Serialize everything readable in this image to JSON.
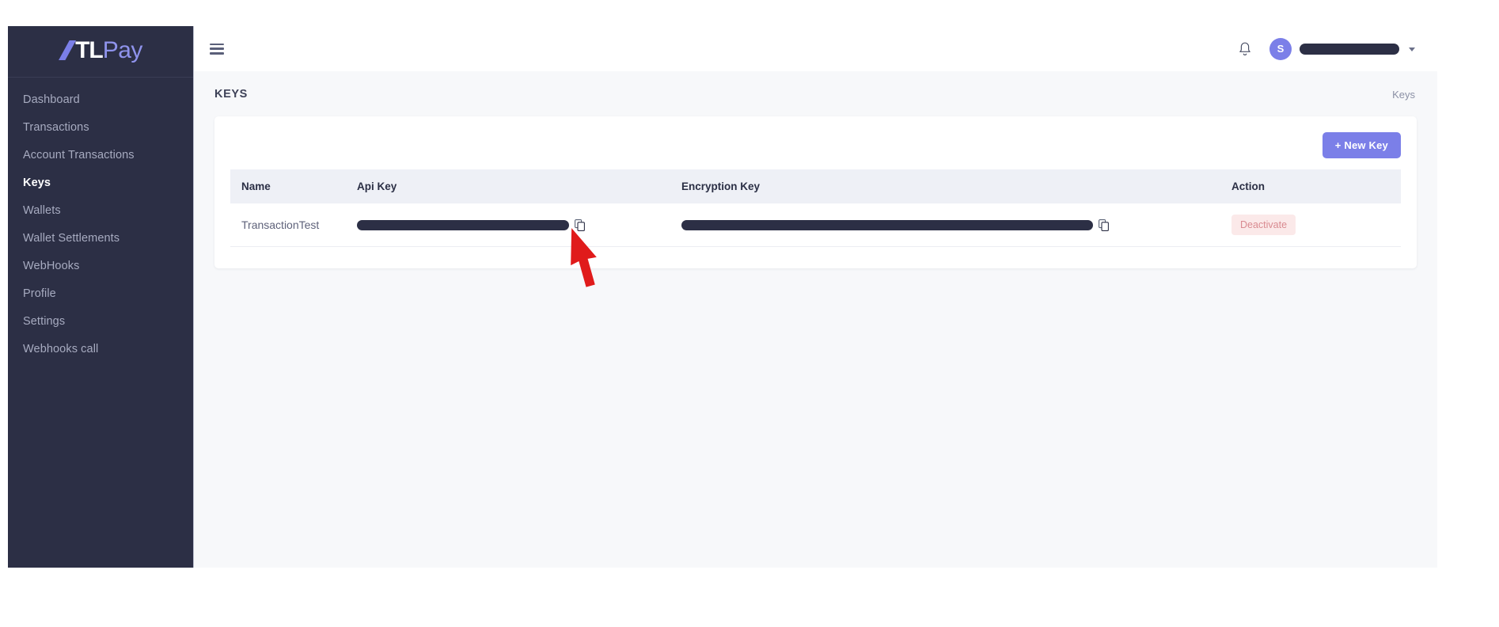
{
  "sidebar": {
    "logo": {
      "mark": "A",
      "bold": "TL",
      "light": "Pay"
    },
    "items": [
      {
        "label": "Dashboard",
        "active": false
      },
      {
        "label": "Transactions",
        "active": false
      },
      {
        "label": "Account Transactions",
        "active": false
      },
      {
        "label": "Keys",
        "active": true
      },
      {
        "label": "Wallets",
        "active": false
      },
      {
        "label": "Wallet Settlements",
        "active": false
      },
      {
        "label": "WebHooks",
        "active": false
      },
      {
        "label": "Profile",
        "active": false
      },
      {
        "label": "Settings",
        "active": false
      },
      {
        "label": "Webhooks call",
        "active": false
      }
    ]
  },
  "header": {
    "menu_icon": "hamburger-icon",
    "notification_icon": "bell-icon",
    "avatar_initial": "S",
    "username": "",
    "caret_icon": "chevron-down-icon"
  },
  "page": {
    "title": "KEYS",
    "breadcrumb": "Keys"
  },
  "toolbar": {
    "new_key_label": "+ New Key"
  },
  "table": {
    "columns": [
      "Name",
      "Api Key",
      "Encryption Key",
      "Action"
    ],
    "rows": [
      {
        "name": "TransactionTest",
        "api_key": "",
        "encryption_key": "",
        "action_label": "Deactivate",
        "copy_icon": "copy-icon"
      }
    ]
  },
  "annotation": {
    "type": "arrow",
    "color": "#e01b1b",
    "points_to": "copy-api-key-icon"
  },
  "colors": {
    "sidebar_bg": "#2c2f45",
    "accent": "#7b7fe8",
    "content_bg": "#f7f8fa",
    "table_header_bg": "#eef0f6",
    "deactivate_bg": "#fbe9e9",
    "deactivate_text": "#d98a90",
    "redaction": "#2c2f45"
  }
}
